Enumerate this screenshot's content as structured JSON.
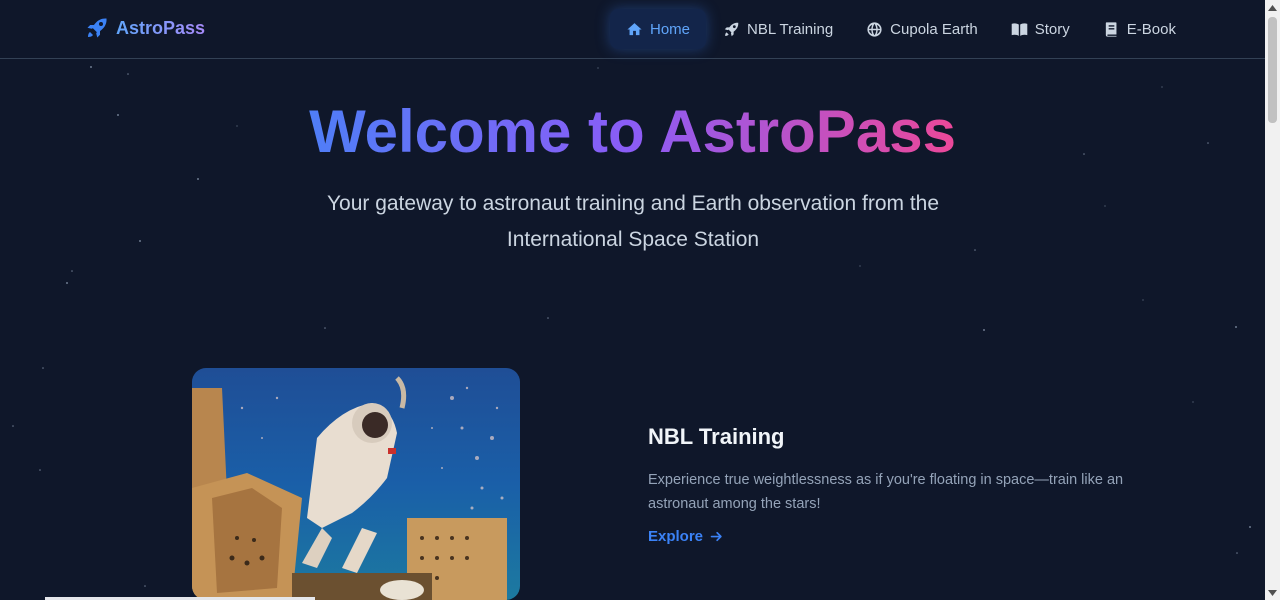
{
  "brand": {
    "name": "AstroPass",
    "icon": "rocket-icon"
  },
  "nav": {
    "items": [
      {
        "label": "Home",
        "icon": "home-icon",
        "active": true
      },
      {
        "label": "NBL Training",
        "icon": "rocket-icon",
        "active": false
      },
      {
        "label": "Cupola Earth",
        "icon": "globe-icon",
        "active": false
      },
      {
        "label": "Story",
        "icon": "book-open-icon",
        "active": false
      },
      {
        "label": "E-Book",
        "icon": "book-icon",
        "active": false
      }
    ]
  },
  "hero": {
    "title": "Welcome to AstroPass",
    "subtitle": "Your gateway to astronaut training and Earth observation from the International Space Station"
  },
  "feature": {
    "title": "NBL Training",
    "description": "Experience true weightlessness as if you're floating in space—train like an astronaut among the stars!",
    "link_label": "Explore",
    "link_icon": "arrow-right-icon"
  },
  "colors": {
    "background": "#0f172a",
    "accent": "#3b82f6",
    "gradient_start": "#4f7ef7",
    "gradient_mid": "#8b5cf6",
    "gradient_end": "#ec4899"
  }
}
